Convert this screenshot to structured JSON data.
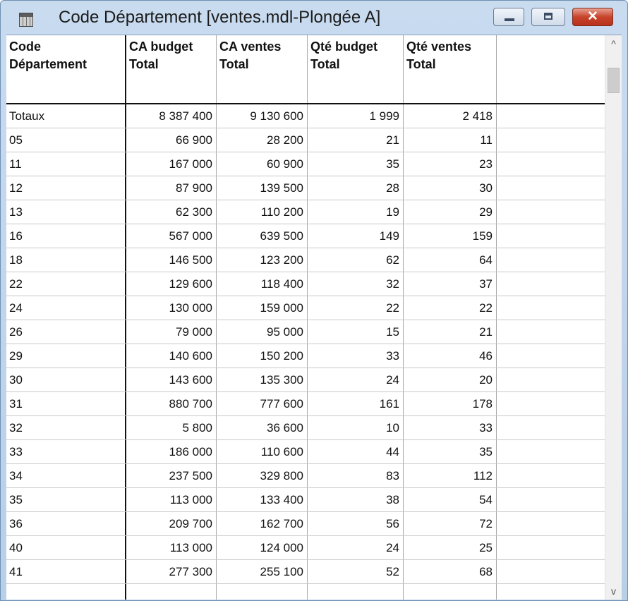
{
  "window": {
    "title": "Code Département [ventes.mdl-Plongée A]",
    "icon": "table-icon",
    "controls": {
      "minimize": "minimize-icon",
      "maximize": "maximize-icon",
      "close": "✕"
    }
  },
  "table": {
    "headers": [
      [
        "Code",
        "Département"
      ],
      [
        "CA budget",
        "Total"
      ],
      [
        "CA ventes",
        "Total"
      ],
      [
        "Qté budget",
        "Total"
      ],
      [
        "Qté ventes",
        "Total"
      ]
    ],
    "rows": [
      [
        "Totaux",
        "8 387 400",
        "9 130 600",
        "1 999",
        "2 418"
      ],
      [
        "05",
        "66 900",
        "28 200",
        "21",
        "11"
      ],
      [
        "11",
        "167 000",
        "60 900",
        "35",
        "23"
      ],
      [
        "12",
        "87 900",
        "139 500",
        "28",
        "30"
      ],
      [
        "13",
        "62 300",
        "110 200",
        "19",
        "29"
      ],
      [
        "16",
        "567 000",
        "639 500",
        "149",
        "159"
      ],
      [
        "18",
        "146 500",
        "123 200",
        "62",
        "64"
      ],
      [
        "22",
        "129 600",
        "118 400",
        "32",
        "37"
      ],
      [
        "24",
        "130 000",
        "159 000",
        "22",
        "22"
      ],
      [
        "26",
        "79 000",
        "95 000",
        "15",
        "21"
      ],
      [
        "29",
        "140 600",
        "150 200",
        "33",
        "46"
      ],
      [
        "30",
        "143 600",
        "135 300",
        "24",
        "20"
      ],
      [
        "31",
        "880 700",
        "777 600",
        "161",
        "178"
      ],
      [
        "32",
        "5 800",
        "36 600",
        "10",
        "33"
      ],
      [
        "33",
        "186 000",
        "110 600",
        "44",
        "35"
      ],
      [
        "34",
        "237 500",
        "329 800",
        "83",
        "112"
      ],
      [
        "35",
        "113 000",
        "133 400",
        "38",
        "54"
      ],
      [
        "36",
        "209 700",
        "162 700",
        "56",
        "72"
      ],
      [
        "40",
        "113 000",
        "124 000",
        "24",
        "25"
      ],
      [
        "41",
        "277 300",
        "255 100",
        "52",
        "68"
      ]
    ]
  },
  "scrollbar": {
    "up": "^",
    "down": "v"
  }
}
